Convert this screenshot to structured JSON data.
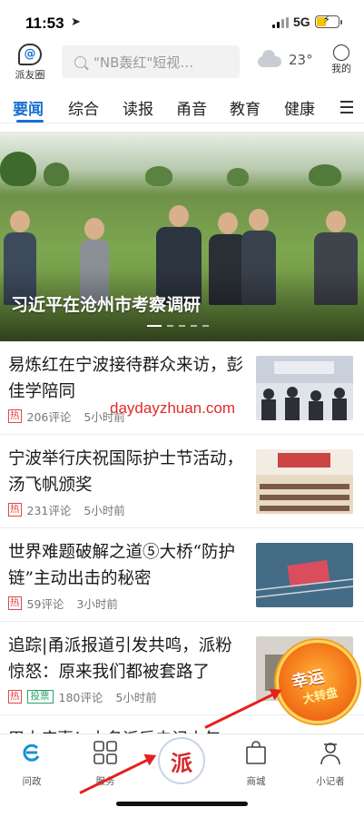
{
  "status": {
    "time": "11:53",
    "network": "5G"
  },
  "header": {
    "pyq_label": "派友圈",
    "search_placeholder": "\"NB轰红\"短视…",
    "temperature": "23°",
    "mine_label": "我的"
  },
  "tabs": [
    "要闻",
    "综合",
    "读报",
    "甬音",
    "教育",
    "健康"
  ],
  "banner": {
    "title": "习近平在沧州市考察调研"
  },
  "watermark": "daydayzhuan.com",
  "news": [
    {
      "title": "易炼红在宁波接待群众来访，彭佳学陪同",
      "badge": "热",
      "comments": "206评论",
      "time": "5小时前"
    },
    {
      "title": "宁波举行庆祝国际护士节活动，汤飞帆颁奖",
      "badge": "热",
      "comments": "231评论",
      "time": "5小时前"
    },
    {
      "title": "世界难题破解之道⑤大桥“防护链”主动出击的秘密",
      "badge": "热",
      "comments": "59评论",
      "time": "3小时前"
    },
    {
      "title": "追踪|甬派报道引发共鸣，派粉惊怒：原来我们都被套路了",
      "badge": "热",
      "badge2": "投票",
      "comments": "180评论",
      "time": "5小时前"
    }
  ],
  "partial_title": "甲木庙惠！十名派后未记士年",
  "lucky": {
    "line1": "幸运",
    "line2": "大转盘"
  },
  "bottom_nav": {
    "left1": "问政",
    "left2": "服务",
    "center": "派",
    "right1": "商城",
    "right2": "小记者"
  }
}
